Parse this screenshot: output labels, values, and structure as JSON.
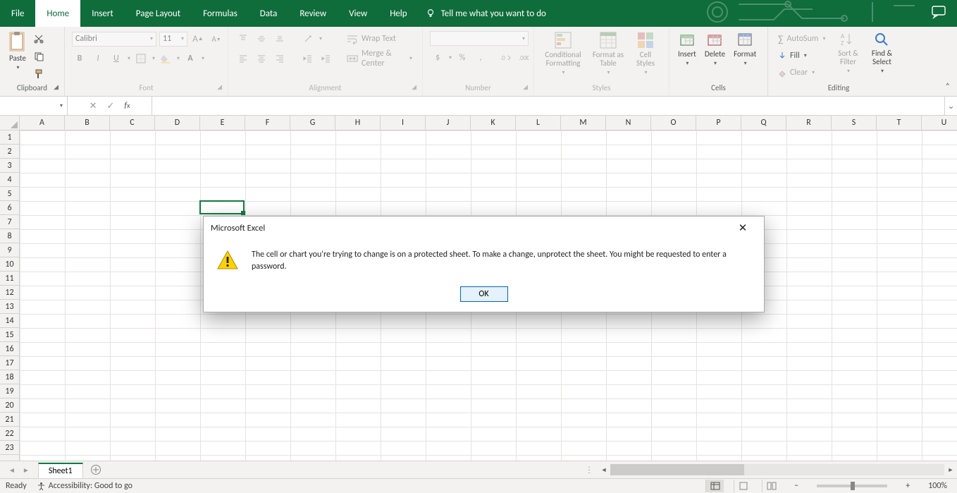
{
  "tabs": [
    "File",
    "Home",
    "Insert",
    "Page Layout",
    "Formulas",
    "Data",
    "Review",
    "View",
    "Help"
  ],
  "active_tab_index": 1,
  "tellme": "Tell me what you want to do",
  "ribbon": {
    "clipboard": {
      "paste": "Paste",
      "label": "Clipboard"
    },
    "font": {
      "name": "Calibri",
      "size": "11",
      "label": "Font"
    },
    "alignment": {
      "wrap": "Wrap Text",
      "merge": "Merge & Center",
      "label": "Alignment"
    },
    "number": {
      "label": "Number"
    },
    "styles": {
      "cond": "Conditional Formatting",
      "table": "Format as Table",
      "cell": "Cell Styles",
      "label": "Styles"
    },
    "cells": {
      "insert": "Insert",
      "delete": "Delete",
      "format": "Format",
      "label": "Cells"
    },
    "editing": {
      "autosum": "AutoSum",
      "fill": "Fill",
      "clear": "Clear",
      "sort": "Sort & Filter",
      "find": "Find & Select",
      "label": "Editing"
    }
  },
  "formula_bar": {
    "name_box": "",
    "fx_value": ""
  },
  "columns": [
    "A",
    "B",
    "C",
    "D",
    "E",
    "F",
    "G",
    "H",
    "I",
    "J",
    "K",
    "L",
    "M",
    "N",
    "O",
    "P",
    "Q",
    "R",
    "S",
    "T",
    "U"
  ],
  "rows_visible": 23,
  "active_cell": {
    "col_index": 4,
    "row_index": 5
  },
  "sheet_tabs": [
    "Sheet1"
  ],
  "dialog": {
    "title": "Microsoft Excel",
    "message": "The cell or chart you're trying to change is on a protected sheet. To make a change, unprotect the sheet. You might be requested to enter a password.",
    "ok": "OK"
  },
  "status": {
    "ready": "Ready",
    "access": "Accessibility: Good to go",
    "zoom": "100%"
  }
}
